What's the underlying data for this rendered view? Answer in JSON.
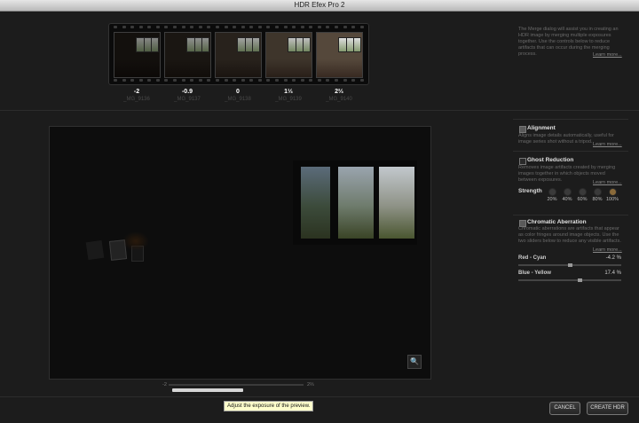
{
  "window": {
    "title": "HDR Efex Pro 2"
  },
  "frames": [
    {
      "ev": "-2",
      "name": "_MG_9136",
      "brightness": 0.12
    },
    {
      "ev": "-0.9",
      "name": "_MG_9137",
      "brightness": 0.2
    },
    {
      "ev": "0",
      "name": "_MG_9138",
      "brightness": 0.35
    },
    {
      "ev": "1⅓",
      "name": "_MG_9139",
      "brightness": 0.6
    },
    {
      "ev": "2⅔",
      "name": "_MG_9140",
      "brightness": 0.85
    }
  ],
  "intro": {
    "text": "The Merge dialog will assist you in creating an HDR image by merging multiple exposures together. Use the controls below to reduce artifacts that can occur during the merging process.",
    "learn_more": "Learn more..."
  },
  "alignment": {
    "label": "Alignment",
    "checked": true,
    "text": "Aligns image details automatically, useful for image series shot without a tripod.",
    "learn_more": "Learn more..."
  },
  "ghost": {
    "label": "Ghost Reduction",
    "checked": false,
    "text": "Removes image artifacts created by merging images together in which objects moved between exposures.",
    "learn_more": "Learn more...",
    "strength_label": "Strength",
    "levels": [
      "20%",
      "40%",
      "60%",
      "80%",
      "100%"
    ],
    "selected_level": "100%"
  },
  "chromatic": {
    "label": "Chromatic Aberration",
    "checked": true,
    "text": "Chromatic aberrations are artifacts that appear as color fringes around image objects. Use the two sliders below to reduce any visible artifacts.",
    "learn_more": "Learn more...",
    "red_cyan": {
      "label": "Red - Cyan",
      "value": "-4.2 %",
      "position": 0.48
    },
    "blue_yellow": {
      "label": "Blue - Yellow",
      "value": "17.4 %",
      "position": 0.58
    }
  },
  "exposure": {
    "min_label": "-2",
    "max_label": "2⅔",
    "tooltip": "Adjust the exposure of the preview."
  },
  "buttons": {
    "cancel": "CANCEL",
    "create": "CREATE HDR"
  },
  "colors": {
    "background": "#1c1c1c",
    "tooltip": "#ffffcc",
    "strength_selected": "#8a6a3a"
  }
}
